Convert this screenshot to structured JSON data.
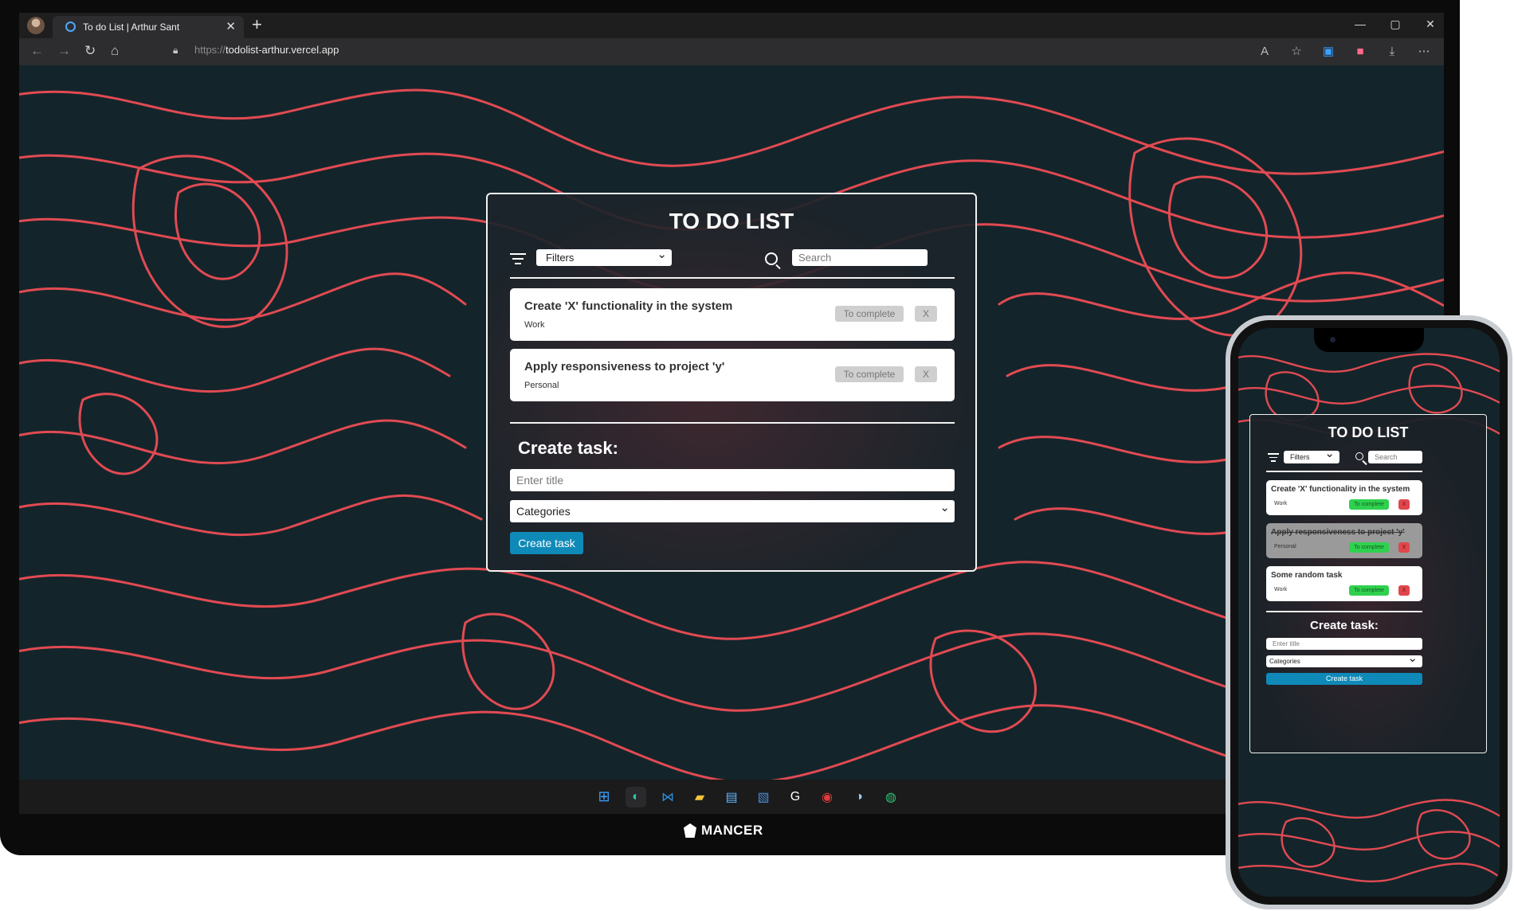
{
  "browser": {
    "tab_title": "To do List | Arthur Sant",
    "tab_close": "✕",
    "new_tab": "+",
    "url_scheme": "https://",
    "url_host": "todolist-arthur.vercel.app",
    "window_controls": [
      "—",
      "▢",
      "✕"
    ],
    "nav_icons": [
      "back-icon",
      "forward-icon",
      "refresh-icon",
      "home-icon"
    ],
    "toolbar_icons": [
      "read-aloud-icon",
      "favorite-icon",
      "capture-icon",
      "extension-icon",
      "download-icon",
      "more-icon"
    ]
  },
  "desktop_app": {
    "title": "TO DO LIST",
    "filters_placeholder": "Filters",
    "search_placeholder": "Search",
    "tasks": [
      {
        "title": "Create 'X' functionality in the system",
        "category": "Work",
        "complete_label": "To complete",
        "remove_label": "X"
      },
      {
        "title": "Apply responsiveness to project 'y'",
        "category": "Personal",
        "complete_label": "To complete",
        "remove_label": "X"
      }
    ],
    "create_heading": "Create task:",
    "title_placeholder": "Enter title",
    "categories_placeholder": "Categories",
    "create_button": "Create task"
  },
  "mobile_app": {
    "title": "TO DO LIST",
    "filters_placeholder": "Filters",
    "search_placeholder": "Search",
    "tasks": [
      {
        "title": "Create 'X' functionality in the system",
        "category": "Work",
        "complete_label": "To complete",
        "remove_label": "X",
        "done": false
      },
      {
        "title": "Apply responsiveness to project 'y'",
        "category": "Personal",
        "complete_label": "To complete",
        "remove_label": "X",
        "done": true
      },
      {
        "title": "Some random task",
        "category": "Work",
        "complete_label": "To complete",
        "remove_label": "X",
        "done": false
      }
    ],
    "create_heading": "Create task:",
    "title_placeholder": "Enter title",
    "categories_placeholder": "Categories",
    "create_button": "Create task"
  },
  "taskbar": {
    "apps": [
      "windows-start-icon",
      "edge-icon",
      "vscode-icon",
      "file-explorer-icon",
      "notepad-icon",
      "photos-icon",
      "logitech-icon",
      "game-icon",
      "steam-icon",
      "edge-canary-icon"
    ]
  },
  "brand": "MANCER",
  "colors": {
    "topo_line": "#e24a52",
    "background": "#13252b",
    "create_button": "#0f8ab8",
    "complete_green": "#2fd14f",
    "remove_red": "#e0474c"
  }
}
